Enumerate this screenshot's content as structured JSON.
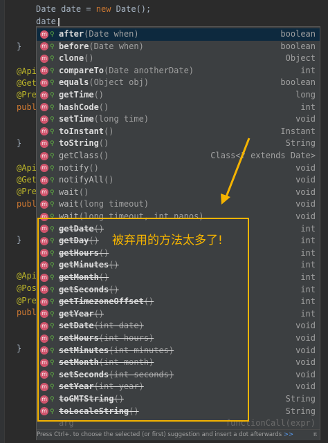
{
  "editor": {
    "line1": {
      "type": "Date",
      "var": "date",
      "op": "=",
      "kw": "new",
      "call": "Date();"
    },
    "line2": "date.",
    "left_annotations": [
      "@Apid",
      "@GetM",
      "@PreA",
      "publ",
      "@Apid",
      "@GetM",
      "@PreA",
      "publ",
      "@Apid",
      "@Post",
      "@PreA",
      "publ"
    ],
    "brace": "}"
  },
  "completion": {
    "items": [
      {
        "name": "after",
        "params": "(Date when)",
        "type": "boolean",
        "bold": true,
        "deprecated": false
      },
      {
        "name": "before",
        "params": "(Date when)",
        "type": "boolean",
        "bold": true,
        "deprecated": false
      },
      {
        "name": "clone",
        "params": "()",
        "type": "Object",
        "bold": true,
        "deprecated": false
      },
      {
        "name": "compareTo",
        "params": "(Date anotherDate)",
        "type": "int",
        "bold": true,
        "deprecated": false
      },
      {
        "name": "equals",
        "params": "(Object obj)",
        "type": "boolean",
        "bold": true,
        "deprecated": false
      },
      {
        "name": "getTime",
        "params": "()",
        "type": "long",
        "bold": true,
        "deprecated": false
      },
      {
        "name": "hashCode",
        "params": "()",
        "type": "int",
        "bold": true,
        "deprecated": false
      },
      {
        "name": "setTime",
        "params": "(long time)",
        "type": "void",
        "bold": true,
        "deprecated": false
      },
      {
        "name": "toInstant",
        "params": "()",
        "type": "Instant",
        "bold": true,
        "deprecated": false
      },
      {
        "name": "toString",
        "params": "()",
        "type": "String",
        "bold": true,
        "deprecated": false
      },
      {
        "name": "getClass",
        "params": "()",
        "type": "Class<? extends Date>",
        "bold": false,
        "deprecated": false
      },
      {
        "name": "notify",
        "params": "()",
        "type": "void",
        "bold": false,
        "deprecated": false
      },
      {
        "name": "notifyAll",
        "params": "()",
        "type": "void",
        "bold": false,
        "deprecated": false
      },
      {
        "name": "wait",
        "params": "()",
        "type": "void",
        "bold": false,
        "deprecated": false
      },
      {
        "name": "wait",
        "params": "(long timeout)",
        "type": "void",
        "bold": false,
        "deprecated": false
      },
      {
        "name": "wait",
        "params": "(long timeout, int nanos)",
        "type": "void",
        "bold": false,
        "deprecated": false
      },
      {
        "name": "getDate",
        "params": "()",
        "type": "int",
        "bold": true,
        "deprecated": true
      },
      {
        "name": "getDay",
        "params": "()",
        "type": "int",
        "bold": true,
        "deprecated": true
      },
      {
        "name": "getHours",
        "params": "()",
        "type": "int",
        "bold": true,
        "deprecated": true
      },
      {
        "name": "getMinutes",
        "params": "()",
        "type": "int",
        "bold": true,
        "deprecated": true
      },
      {
        "name": "getMonth",
        "params": "()",
        "type": "int",
        "bold": true,
        "deprecated": true
      },
      {
        "name": "getSeconds",
        "params": "()",
        "type": "int",
        "bold": true,
        "deprecated": true
      },
      {
        "name": "getTimezoneOffset",
        "params": "()",
        "type": "int",
        "bold": true,
        "deprecated": true
      },
      {
        "name": "getYear",
        "params": "()",
        "type": "int",
        "bold": true,
        "deprecated": true
      },
      {
        "name": "setDate",
        "params": "(int date)",
        "type": "void",
        "bold": true,
        "deprecated": true
      },
      {
        "name": "setHours",
        "params": "(int hours)",
        "type": "void",
        "bold": true,
        "deprecated": true
      },
      {
        "name": "setMinutes",
        "params": "(int minutes)",
        "type": "void",
        "bold": true,
        "deprecated": true
      },
      {
        "name": "setMonth",
        "params": "(int month)",
        "type": "void",
        "bold": true,
        "deprecated": true
      },
      {
        "name": "setSeconds",
        "params": "(int seconds)",
        "type": "void",
        "bold": true,
        "deprecated": true
      },
      {
        "name": "setYear",
        "params": "(int year)",
        "type": "void",
        "bold": true,
        "deprecated": true
      },
      {
        "name": "toGMTString",
        "params": "()",
        "type": "String",
        "bold": true,
        "deprecated": true
      },
      {
        "name": "toLocaleString",
        "params": "()",
        "type": "String",
        "bold": true,
        "deprecated": true
      },
      {
        "name": "arg",
        "params": "",
        "type": "functionCall(expr)",
        "bold": false,
        "deprecated": false,
        "faded": true
      }
    ],
    "method_icon_letter": "m",
    "footer": {
      "hint": "Press Ctrl+. to choose the selected (or first) suggestion and insert a dot afterwards",
      "link": ">>",
      "pi": "π"
    }
  },
  "annotation": {
    "callout_text": "被弃用的方法太多了!",
    "color": "#f5b400"
  },
  "colors": {
    "editor_bg": "#2b2b2b",
    "popup_bg": "#3c3f41",
    "selected_bg": "#0d293e",
    "method_icon": "#d0546c",
    "annotation_yellow": "#bbb529",
    "keyword_orange": "#cc7832"
  }
}
